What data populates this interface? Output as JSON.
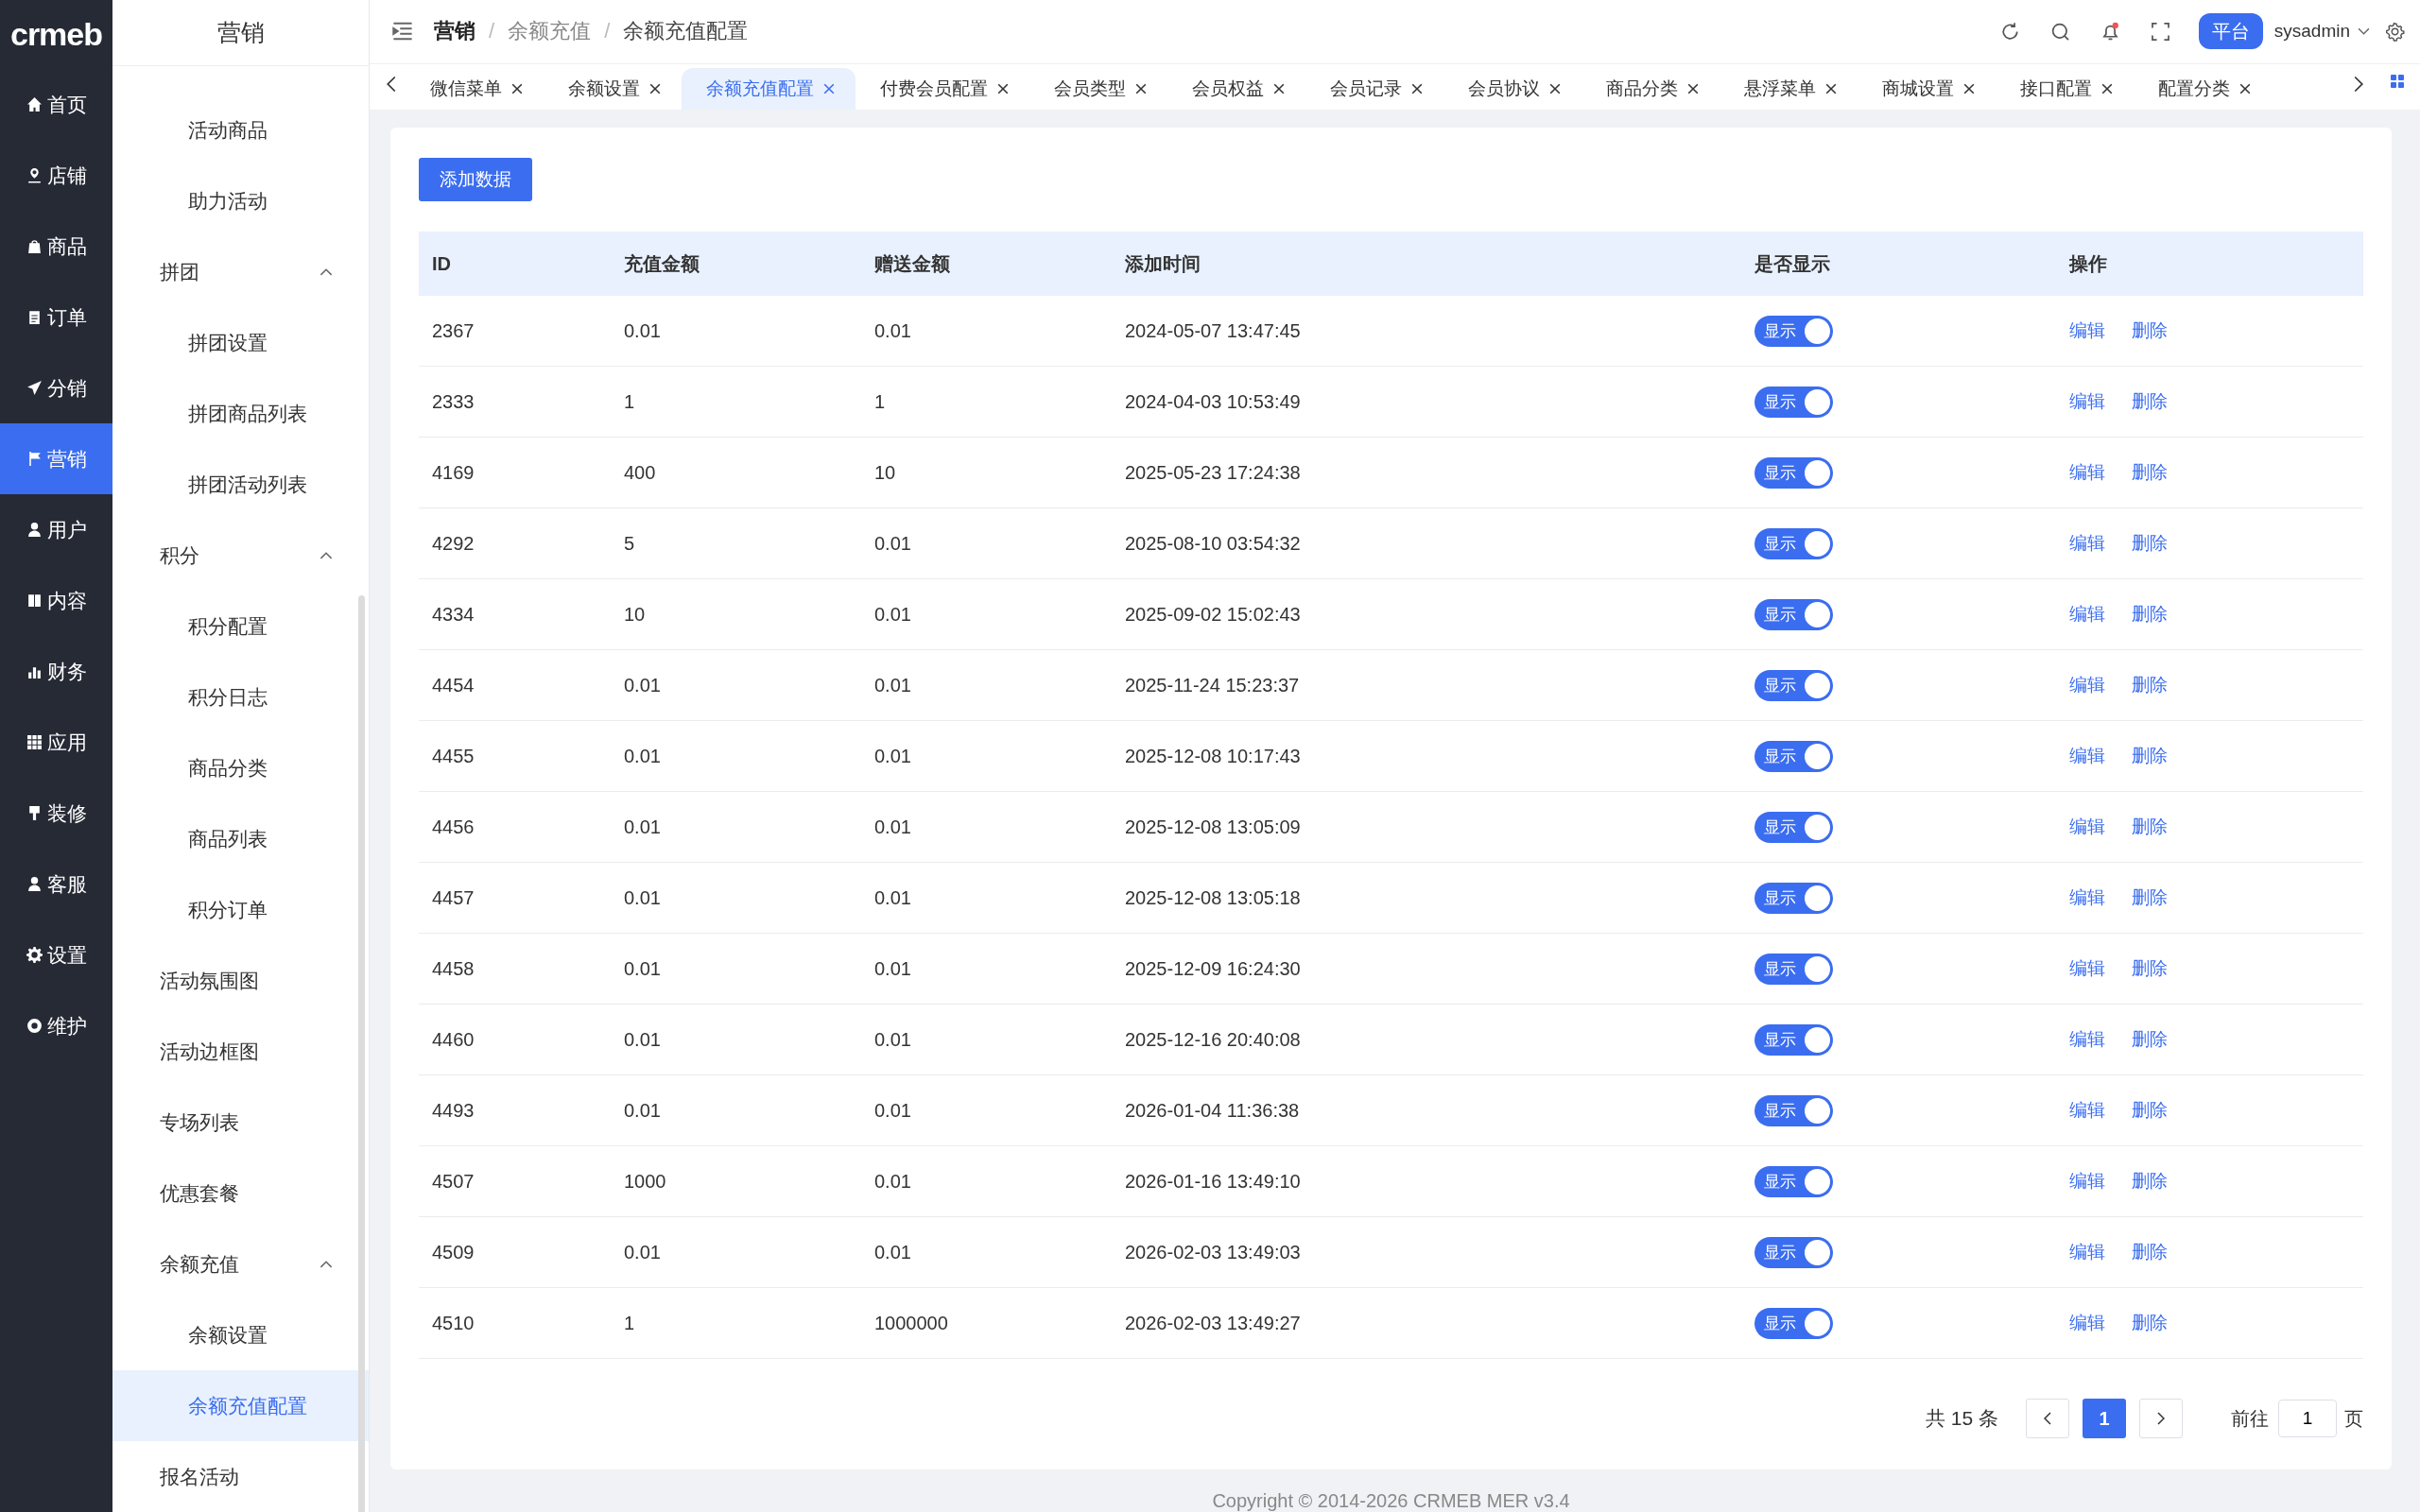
{
  "logo": "crmeb",
  "rail": [
    {
      "label": "首页",
      "selected": false
    },
    {
      "label": "店铺",
      "selected": false
    },
    {
      "label": "商品",
      "selected": false
    },
    {
      "label": "订单",
      "selected": false
    },
    {
      "label": "分销",
      "selected": false
    },
    {
      "label": "营销",
      "selected": true
    },
    {
      "label": "用户",
      "selected": false
    },
    {
      "label": "内容",
      "selected": false
    },
    {
      "label": "财务",
      "selected": false
    },
    {
      "label": "应用",
      "selected": false
    },
    {
      "label": "装修",
      "selected": false
    },
    {
      "label": "客服",
      "selected": false
    },
    {
      "label": "设置",
      "selected": false
    },
    {
      "label": "维护",
      "selected": false
    }
  ],
  "menu": {
    "title": "营销",
    "items": [
      {
        "children": [
          {
            "label": "活动商品",
            "selected": false
          },
          {
            "label": "助力活动",
            "selected": false
          }
        ]
      },
      {
        "label": "拼团",
        "expanded": true,
        "children": [
          {
            "label": "拼团设置",
            "selected": false
          },
          {
            "label": "拼团商品列表",
            "selected": false
          },
          {
            "label": "拼团活动列表",
            "selected": false
          }
        ]
      },
      {
        "label": "积分",
        "expanded": true,
        "children": [
          {
            "label": "积分配置",
            "selected": false
          },
          {
            "label": "积分日志",
            "selected": false
          },
          {
            "label": "商品分类",
            "selected": false
          },
          {
            "label": "商品列表",
            "selected": false
          },
          {
            "label": "积分订单",
            "selected": false
          }
        ]
      },
      {
        "label": "活动氛围图",
        "selected": false
      },
      {
        "label": "活动边框图",
        "selected": false
      },
      {
        "label": "专场列表",
        "selected": false
      },
      {
        "label": "优惠套餐",
        "selected": false
      },
      {
        "label": "余额充值",
        "expanded": true,
        "children": [
          {
            "label": "余额设置",
            "selected": false
          },
          {
            "label": "余额充值配置",
            "selected": true
          }
        ]
      },
      {
        "label": "报名活动",
        "selected": false
      }
    ]
  },
  "breadcrumbs": [
    "营销",
    "余额充值",
    "余额充值配置"
  ],
  "breadcrumb_separators": [
    "/",
    "/"
  ],
  "header": {
    "platform_button": "平台",
    "user": "sysadmin"
  },
  "tabs": [
    {
      "label": "微信菜单",
      "selected": false
    },
    {
      "label": "余额设置",
      "selected": false
    },
    {
      "label": "余额充值配置",
      "selected": true
    },
    {
      "label": "付费会员配置",
      "selected": false
    },
    {
      "label": "会员类型",
      "selected": false
    },
    {
      "label": "会员权益",
      "selected": false
    },
    {
      "label": "会员记录",
      "selected": false
    },
    {
      "label": "会员协议",
      "selected": false
    },
    {
      "label": "商品分类",
      "selected": false
    },
    {
      "label": "悬浮菜单",
      "selected": false
    },
    {
      "label": "商城设置",
      "selected": false
    },
    {
      "label": "接口配置",
      "selected": false
    },
    {
      "label": "配置分类",
      "selected": false
    }
  ],
  "add_button": "添加数据",
  "table": {
    "columns": [
      "ID",
      "充值金额",
      "赠送金额",
      "添加时间",
      "是否显示",
      "操作"
    ],
    "rows": [
      {
        "id": "2367",
        "amount": "0.01",
        "bonus": "0.01",
        "time": "2024-05-07 13:47:45",
        "shown": true,
        "switch_label": "显示",
        "edit": "编辑",
        "delete": "删除"
      },
      {
        "id": "2333",
        "amount": "1",
        "bonus": "1",
        "time": "2024-04-03 10:53:49",
        "shown": true,
        "switch_label": "显示",
        "edit": "编辑",
        "delete": "删除"
      },
      {
        "id": "4169",
        "amount": "400",
        "bonus": "10",
        "time": "2025-05-23 17:24:38",
        "shown": true,
        "switch_label": "显示",
        "edit": "编辑",
        "delete": "删除"
      },
      {
        "id": "4292",
        "amount": "5",
        "bonus": "0.01",
        "time": "2025-08-10 03:54:32",
        "shown": true,
        "switch_label": "显示",
        "edit": "编辑",
        "delete": "删除"
      },
      {
        "id": "4334",
        "amount": "10",
        "bonus": "0.01",
        "time": "2025-09-02 15:02:43",
        "shown": true,
        "switch_label": "显示",
        "edit": "编辑",
        "delete": "删除"
      },
      {
        "id": "4454",
        "amount": "0.01",
        "bonus": "0.01",
        "time": "2025-11-24 15:23:37",
        "shown": true,
        "switch_label": "显示",
        "edit": "编辑",
        "delete": "删除"
      },
      {
        "id": "4455",
        "amount": "0.01",
        "bonus": "0.01",
        "time": "2025-12-08 10:17:43",
        "shown": true,
        "switch_label": "显示",
        "edit": "编辑",
        "delete": "删除"
      },
      {
        "id": "4456",
        "amount": "0.01",
        "bonus": "0.01",
        "time": "2025-12-08 13:05:09",
        "shown": true,
        "switch_label": "显示",
        "edit": "编辑",
        "delete": "删除"
      },
      {
        "id": "4457",
        "amount": "0.01",
        "bonus": "0.01",
        "time": "2025-12-08 13:05:18",
        "shown": true,
        "switch_label": "显示",
        "edit": "编辑",
        "delete": "删除"
      },
      {
        "id": "4458",
        "amount": "0.01",
        "bonus": "0.01",
        "time": "2025-12-09 16:24:30",
        "shown": true,
        "switch_label": "显示",
        "edit": "编辑",
        "delete": "删除"
      },
      {
        "id": "4460",
        "amount": "0.01",
        "bonus": "0.01",
        "time": "2025-12-16 20:40:08",
        "shown": true,
        "switch_label": "显示",
        "edit": "编辑",
        "delete": "删除"
      },
      {
        "id": "4493",
        "amount": "0.01",
        "bonus": "0.01",
        "time": "2026-01-04 11:36:38",
        "shown": true,
        "switch_label": "显示",
        "edit": "编辑",
        "delete": "删除"
      },
      {
        "id": "4507",
        "amount": "1000",
        "bonus": "0.01",
        "time": "2026-01-16 13:49:10",
        "shown": true,
        "switch_label": "显示",
        "edit": "编辑",
        "delete": "删除"
      },
      {
        "id": "4509",
        "amount": "0.01",
        "bonus": "0.01",
        "time": "2026-02-03 13:49:03",
        "shown": true,
        "switch_label": "显示",
        "edit": "编辑",
        "delete": "删除"
      },
      {
        "id": "4510",
        "amount": "1",
        "bonus": "1000000",
        "time": "2026-02-03 13:49:27",
        "shown": true,
        "switch_label": "显示",
        "edit": "编辑",
        "delete": "删除"
      }
    ]
  },
  "pagination": {
    "total": "共 15 条",
    "pages": [
      {
        "label": "1",
        "selected": true
      }
    ],
    "goto_label": "前往",
    "goto_value": "1",
    "goto_suffix": "页"
  },
  "footer": "Copyright © 2014-2026 CRMEB MER v3.4"
}
